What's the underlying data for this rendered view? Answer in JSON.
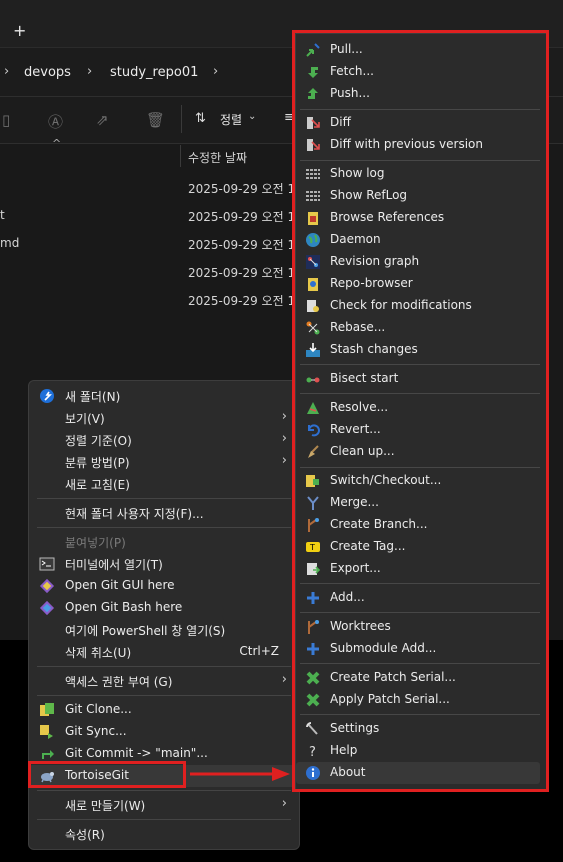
{
  "titlebar": {
    "new_tab": "+"
  },
  "address": {
    "crumbs": [
      "devops",
      "study_repo01"
    ]
  },
  "toolbar": {
    "sort_label": "정렬"
  },
  "columns": {
    "modified": "수정한 날짜"
  },
  "files": {
    "dates": [
      "2025-09-29 오전 1",
      "2025-09-29 오전 1",
      "2025-09-29 오전 1",
      "2025-09-29 오전 1",
      "2025-09-29 오전 1"
    ],
    "name_fragments": [
      "t",
      "md"
    ]
  },
  "context_menu": {
    "items": [
      {
        "label": "새 폴더(N)"
      },
      {
        "label": "보기(V)"
      },
      {
        "label": "정렬 기준(O)"
      },
      {
        "label": "분류 방법(P)"
      },
      {
        "label": "새로 고침(E)"
      },
      {
        "label": "현재 폴더 사용자 지정(F)..."
      },
      {
        "label": "붙여넣기(P)"
      },
      {
        "label": "터미널에서 열기(T)"
      },
      {
        "label": "Open Git GUI here"
      },
      {
        "label": "Open Git Bash here"
      },
      {
        "label": "여기에 PowerShell 창 열기(S)"
      },
      {
        "label": "삭제 취소(U)",
        "shortcut": "Ctrl+Z"
      },
      {
        "label": "액세스 권한 부여 (G)"
      },
      {
        "label": "Git Clone..."
      },
      {
        "label": "Git Sync..."
      },
      {
        "label": "Git Commit -> \"main\"..."
      },
      {
        "label": "TortoiseGit"
      },
      {
        "label": "새로 만들기(W)"
      },
      {
        "label": "속성(R)"
      }
    ]
  },
  "tortoise_menu": {
    "items": [
      {
        "label": "Pull...",
        "icon": "pull-icon"
      },
      {
        "label": "Fetch...",
        "icon": "fetch-icon"
      },
      {
        "label": "Push...",
        "icon": "push-icon"
      },
      {
        "label": "Diff",
        "icon": "diff-icon"
      },
      {
        "label": "Diff with previous version",
        "icon": "diff-prev-icon"
      },
      {
        "label": "Show log",
        "icon": "log-icon"
      },
      {
        "label": "Show RefLog",
        "icon": "reflog-icon"
      },
      {
        "label": "Browse References",
        "icon": "references-icon"
      },
      {
        "label": "Daemon",
        "icon": "globe-icon"
      },
      {
        "label": "Revision graph",
        "icon": "graph-icon"
      },
      {
        "label": "Repo-browser",
        "icon": "repo-icon"
      },
      {
        "label": "Check for modifications",
        "icon": "check-icon"
      },
      {
        "label": "Rebase...",
        "icon": "rebase-icon"
      },
      {
        "label": "Stash changes",
        "icon": "stash-icon"
      },
      {
        "label": "Bisect start",
        "icon": "bisect-icon"
      },
      {
        "label": "Resolve...",
        "icon": "resolve-icon"
      },
      {
        "label": "Revert...",
        "icon": "revert-icon"
      },
      {
        "label": "Clean up...",
        "icon": "broom-icon"
      },
      {
        "label": "Switch/Checkout...",
        "icon": "switch-icon"
      },
      {
        "label": "Merge...",
        "icon": "merge-icon"
      },
      {
        "label": "Create Branch...",
        "icon": "branch-icon"
      },
      {
        "label": "Create Tag...",
        "icon": "tag-icon"
      },
      {
        "label": "Export...",
        "icon": "export-icon"
      },
      {
        "label": "Add...",
        "icon": "add-icon"
      },
      {
        "label": "Worktrees",
        "icon": "worktree-icon"
      },
      {
        "label": "Submodule Add...",
        "icon": "submodule-icon"
      },
      {
        "label": "Create Patch Serial...",
        "icon": "patch-create-icon"
      },
      {
        "label": "Apply Patch Serial...",
        "icon": "patch-apply-icon"
      },
      {
        "label": "Settings",
        "icon": "settings-icon"
      },
      {
        "label": "Help",
        "icon": "help-icon"
      },
      {
        "label": "About",
        "icon": "info-icon"
      }
    ]
  },
  "colors": {
    "highlight": "#e02020",
    "menu_bg": "#2b2b2b"
  }
}
